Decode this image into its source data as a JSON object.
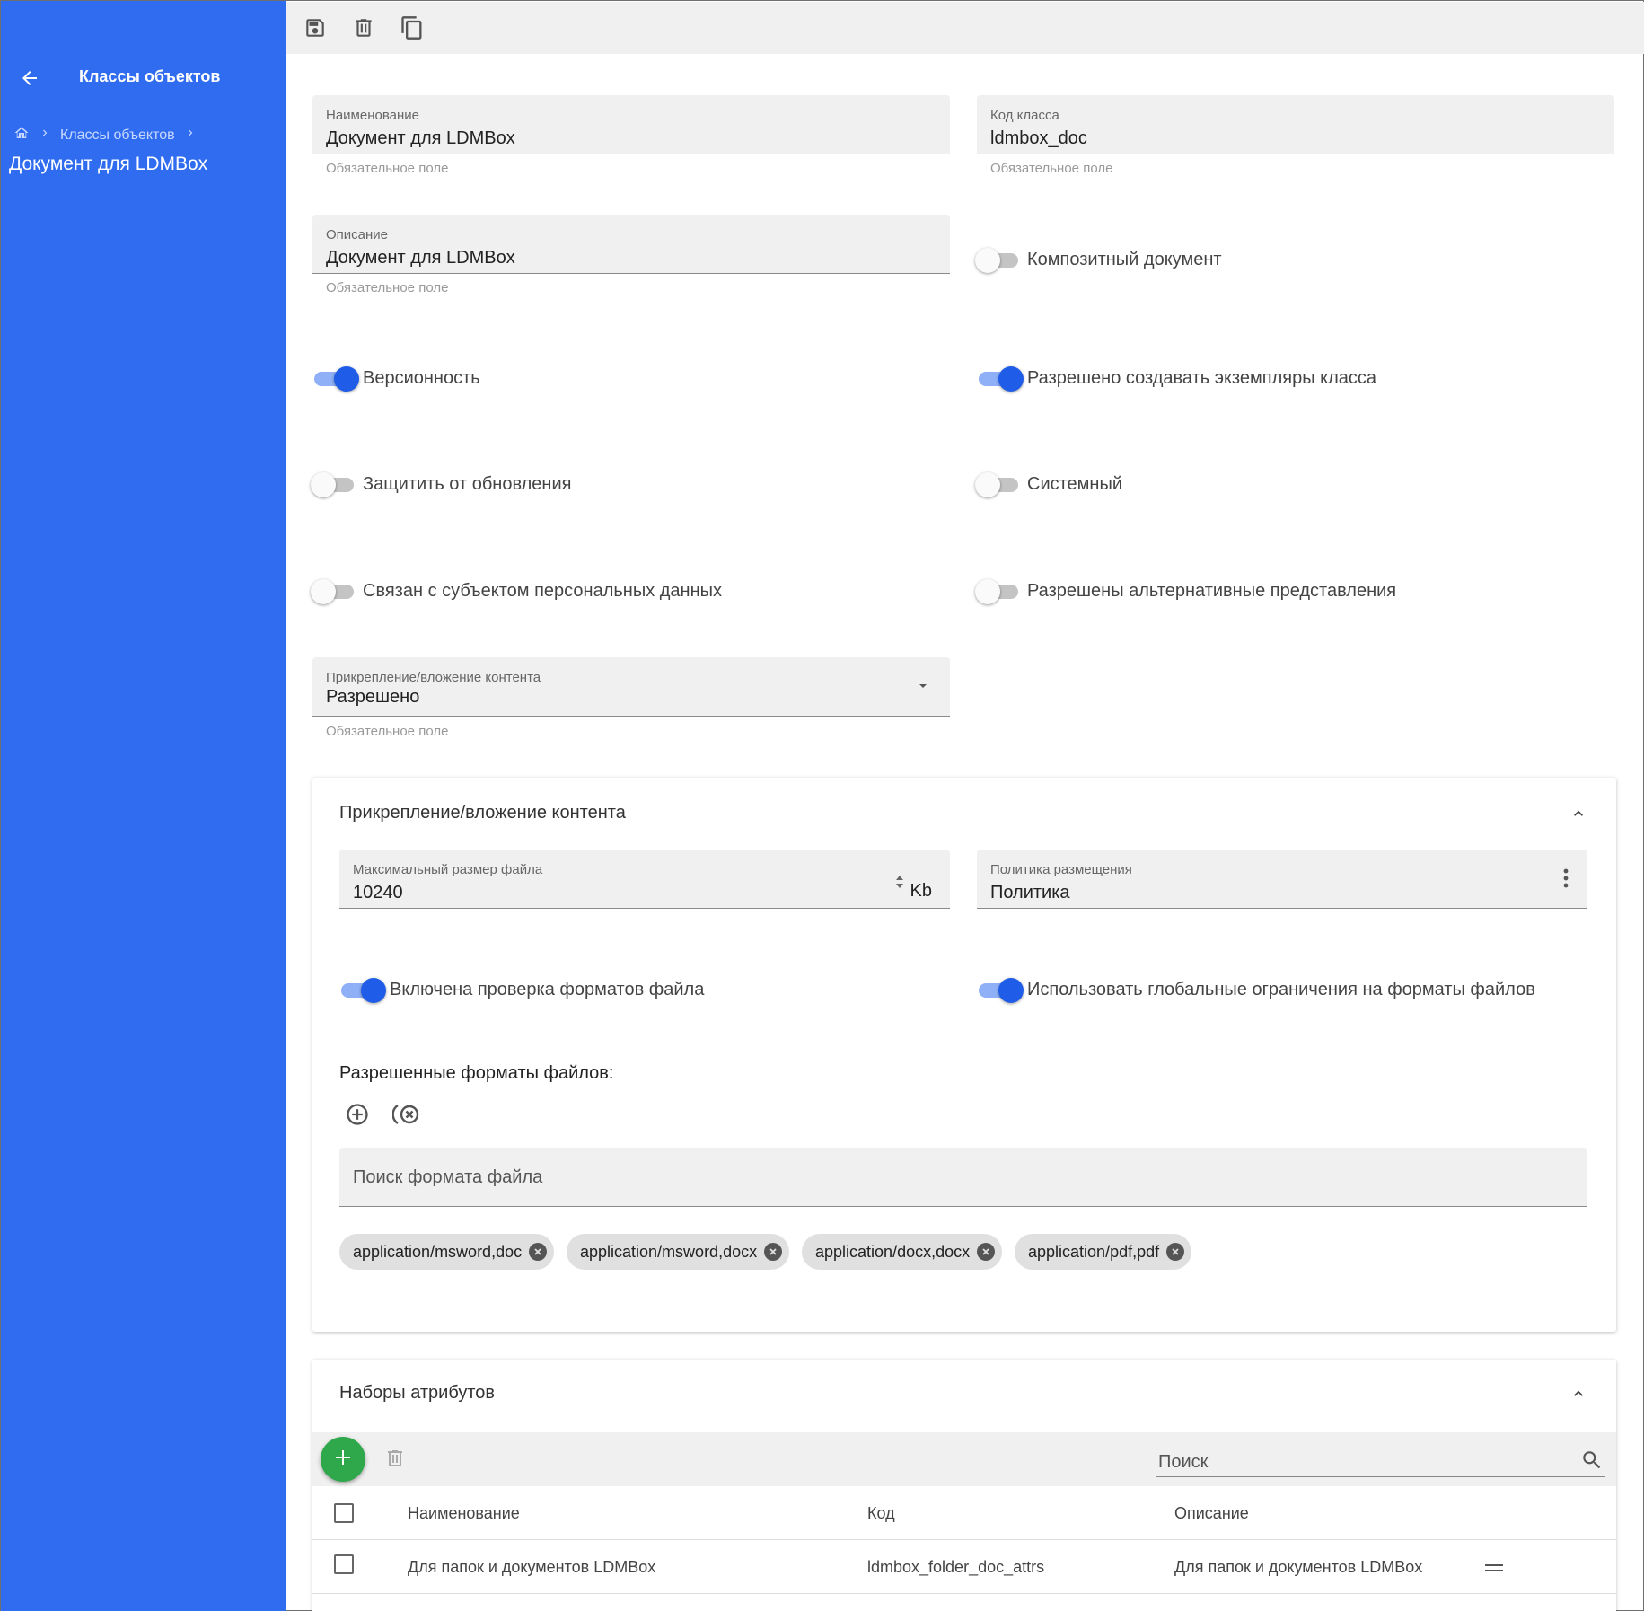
{
  "sidebar": {
    "title": "Классы объектов",
    "breadcrumb": {
      "link": "Классы объектов"
    },
    "current": "Документ для LDMBox"
  },
  "form": {
    "name": {
      "label": "Наименование",
      "value": "Документ для LDMBox",
      "hint": "Обязательное поле"
    },
    "code": {
      "label": "Код класса",
      "value": "ldmbox_doc",
      "hint": "Обязательное поле"
    },
    "description": {
      "label": "Описание",
      "value": "Документ для LDMBox",
      "hint": "Обязательное поле"
    },
    "toggles": {
      "composite": {
        "label": "Композитный документ",
        "on": false
      },
      "versioning": {
        "label": "Версионность",
        "on": true
      },
      "allow_instances": {
        "label": "Разрешено создавать экземпляры класса",
        "on": true
      },
      "protect": {
        "label": "Защитить от обновления",
        "on": false
      },
      "system": {
        "label": "Системный",
        "on": false
      },
      "personal": {
        "label": "Связан с субъектом персональных данных",
        "on": false
      },
      "alt_views": {
        "label": "Разрешены альтернативные представления",
        "on": false
      }
    },
    "content_attach": {
      "label": "Прикрепление/вложение контента",
      "value": "Разрешено",
      "hint": "Обязательное поле"
    }
  },
  "content_card": {
    "title": "Прикрепление/вложение контента",
    "max_size": {
      "label": "Максимальный размер файла",
      "value": "10240",
      "unit": "Kb"
    },
    "policy": {
      "label": "Политика размещения",
      "value": "Политика"
    },
    "check_formats": {
      "label": "Включена проверка форматов файла",
      "on": true
    },
    "global_limits": {
      "label": "Использовать глобальные ограничения на форматы файлов",
      "on": true
    },
    "formats_title": "Разрешенные форматы файлов:",
    "search_placeholder": "Поиск формата файла",
    "chips": [
      "application/msword,doc",
      "application/msword,docx",
      "application/docx,docx",
      "application/pdf,pdf"
    ]
  },
  "attrs_card": {
    "title": "Наборы атрибутов",
    "search_placeholder": "Поиск",
    "columns": {
      "name": "Наименование",
      "code": "Код",
      "description": "Описание"
    },
    "rows": [
      {
        "name": "Для папок и документов LDMBox",
        "code": "ldmbox_folder_doc_attrs",
        "description": "Для папок и документов LDMBox"
      }
    ]
  },
  "colors": {
    "sidebar": "#2f6cf0",
    "accent": "#1f5de9",
    "fab": "#2ea84a"
  }
}
